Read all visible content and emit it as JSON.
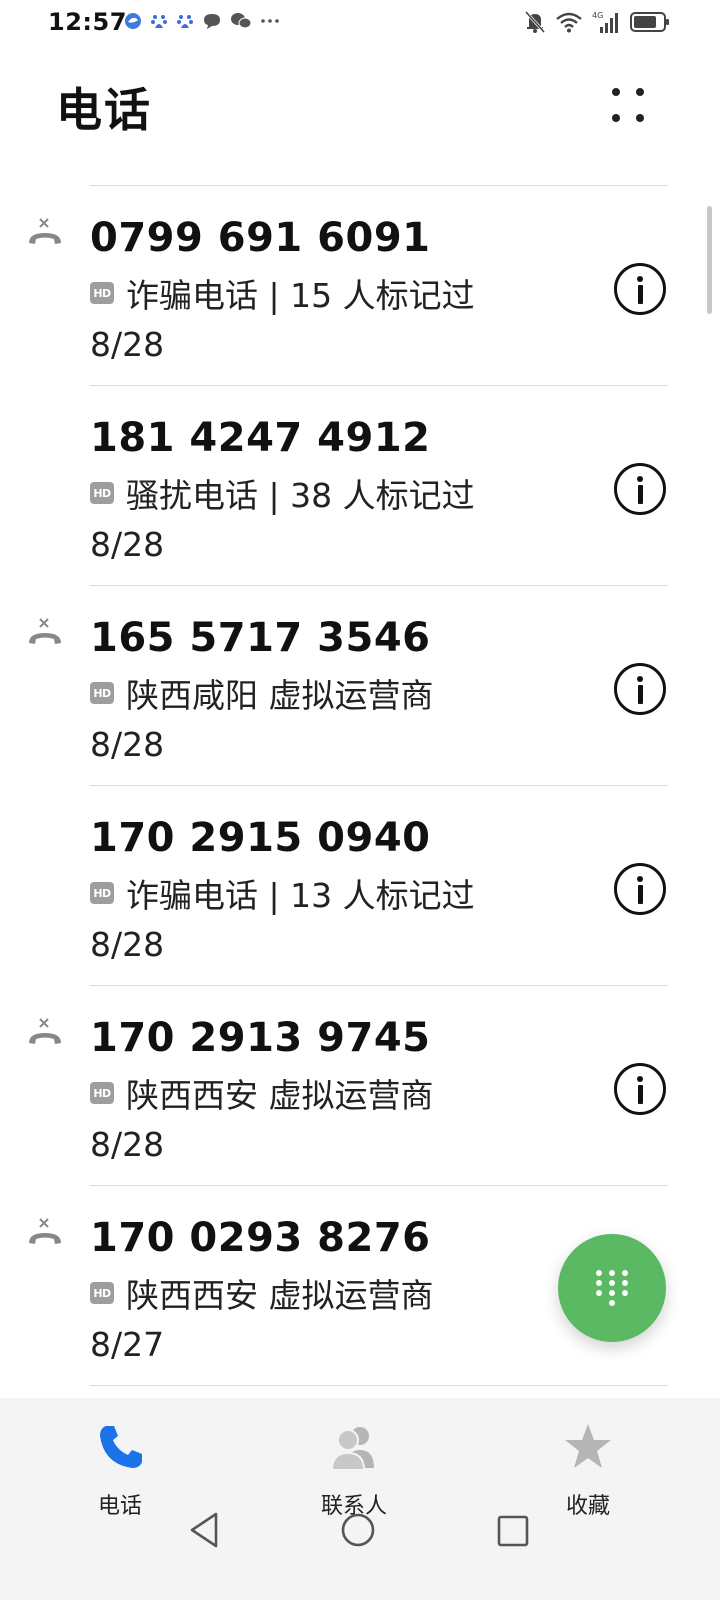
{
  "status_bar": {
    "time": "12:57",
    "icons": [
      "browser-icon",
      "baidu-paw-icon",
      "baidu-paw-icon",
      "message-bubble-icon",
      "wechat-icon",
      "more-dots-icon",
      "mute-bell-icon",
      "wifi-icon",
      "signal-4g-icon",
      "battery-icon"
    ],
    "network_label": "4G"
  },
  "header": {
    "title": "电话",
    "more_icon": "dots-grid-icon"
  },
  "calls": [
    {
      "number": "0799 691 6091",
      "description": "诈骗电话 | 15 人标记过",
      "date": "8/28",
      "missed": true,
      "hd": "HD"
    },
    {
      "number": "181 4247 4912",
      "description": "骚扰电话 | 38 人标记过",
      "date": "8/28",
      "missed": false,
      "hd": "HD"
    },
    {
      "number": "165 5717 3546",
      "description": "陕西咸阳 虚拟运营商",
      "date": "8/28",
      "missed": true,
      "hd": "HD"
    },
    {
      "number": "170 2915 0940",
      "description": "诈骗电话 | 13 人标记过",
      "date": "8/28",
      "missed": false,
      "hd": "HD"
    },
    {
      "number": "170 2913 9745",
      "description": "陕西西安 虚拟运营商",
      "date": "8/28",
      "missed": true,
      "hd": "HD"
    },
    {
      "number": "170 0293 8276",
      "description": "陕西西安 虚拟运营商",
      "date": "8/27",
      "missed": true,
      "hd": "HD"
    }
  ],
  "fab": {
    "icon": "dialpad-icon",
    "color": "#5ab962"
  },
  "bottom_nav": {
    "tabs": [
      {
        "label": "电话",
        "icon": "phone-icon",
        "active": true,
        "color": "#1a73e8"
      },
      {
        "label": "联系人",
        "icon": "contacts-icon",
        "active": false,
        "color": "#b5b5b5"
      },
      {
        "label": "收藏",
        "icon": "star-icon",
        "active": false,
        "color": "#b5b5b5"
      }
    ]
  },
  "system_nav": [
    "back-icon",
    "home-icon",
    "recents-icon"
  ]
}
